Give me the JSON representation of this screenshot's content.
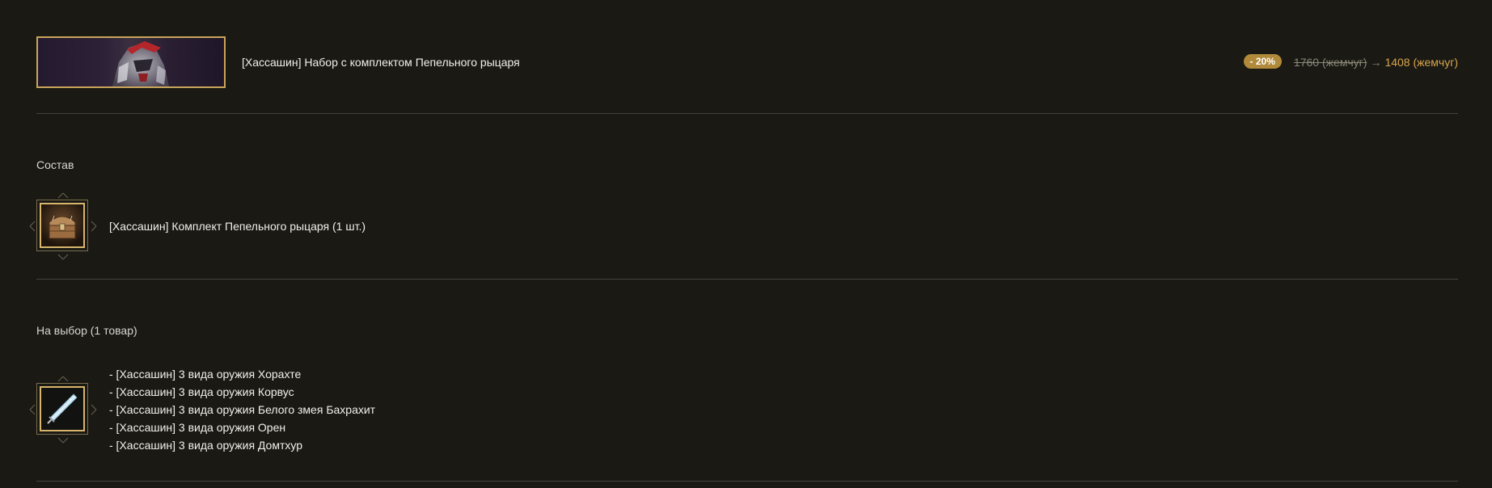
{
  "product": {
    "title": "[Хассашин] Набор с комплектом Пепельного рыцаря",
    "banner_icon": "ash-knight-banner-image"
  },
  "price": {
    "discount": "- 20%",
    "old": "1760 (жемчуг)",
    "arrow": "→",
    "new": "1408 (жемчуг)",
    "accent_color": "#d8a64b",
    "badge_color": "#b08a3a"
  },
  "composition": {
    "label": "Состав",
    "item": {
      "icon": "treasure-chest-icon",
      "name": "[Хассашин] Комплект Пепельного рыцаря (1 шт.)"
    }
  },
  "choice": {
    "label": "На выбор (1 товар)",
    "icon": "sword-icon",
    "items": [
      "- [Хассашин] 3 вида оружия Хорахте",
      "- [Хассашин] 3 вида оружия Корвус",
      "- [Хассашин] 3 вида оружия Белого змея Бахрахит",
      "- [Хассашин] 3 вида оружия Орен",
      "- [Хассашин] 3 вида оружия Домтхур"
    ]
  }
}
